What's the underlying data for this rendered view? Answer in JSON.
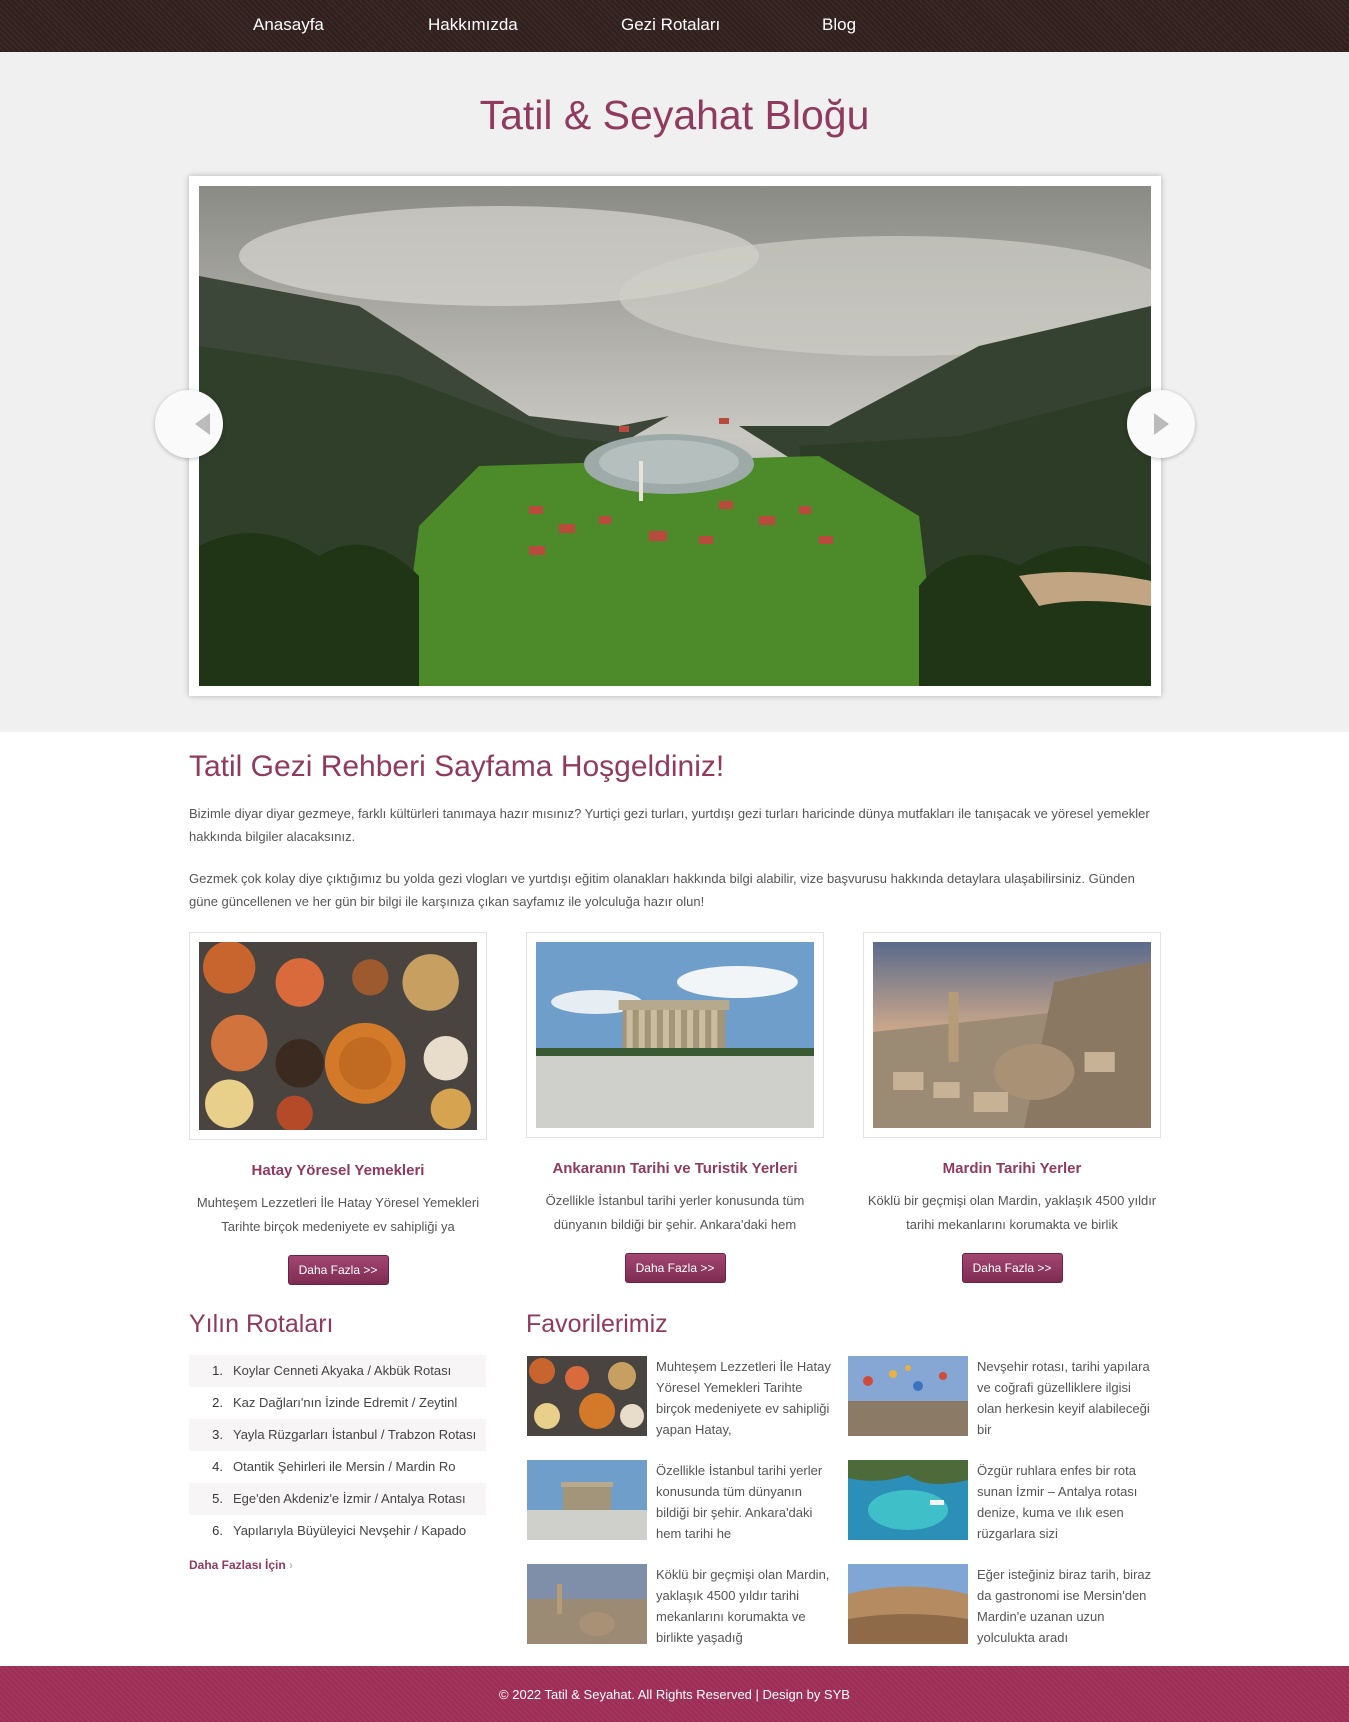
{
  "nav": {
    "items": [
      "Anasayfa",
      "Hakkımızda",
      "Gezi Rotaları",
      "Blog"
    ]
  },
  "hero": {
    "title": "Tatil & Seyahat Bloğu"
  },
  "welcome": {
    "title": "Tatil Gezi Rehberi Sayfama Hoşgeldiniz!",
    "p1": "Bizimle diyar diyar gezmeye, farklı kültürleri tanımaya hazır mısınız? Yurtiçi gezi turları, yurtdışı gezi turları haricinde dünya mutfakları ile tanışacak ve yöresel yemekler hakkında bilgiler alacaksınız.",
    "p2": "Gezmek çok kolay diye çıktığımız bu yolda gezi vlogları ve yurtdışı eğitim olanakları hakkında bilgi alabilir, vize başvurusu hakkında detaylara ulaşabilirsiniz. Günden güne güncellenen ve her gün bir bilgi ile karşınıza çıkan sayfamız ile yolculuğa hazır olun!"
  },
  "cards": [
    {
      "title": "Hatay Yöresel Yemekleri",
      "text": "Muhteşem Lezzetleri İle Hatay Yöresel Yemekleri Tarihte birçok medeniyete ev sahipliği ya",
      "button": "Daha Fazla >>"
    },
    {
      "title": "Ankaranın Tarihi ve Turistik Yerleri",
      "text": "Özellikle İstanbul tarihi yerler konusunda tüm dünyanın bildiği bir şehir. Ankara'daki hem",
      "button": "Daha Fazla >>"
    },
    {
      "title": "Mardin Tarihi Yerler",
      "text": "Köklü bir geçmişi olan Mardin, yaklaşık 4500 yıldır tarihi mekanlarını korumakta ve birlik",
      "button": "Daha Fazla >>"
    }
  ],
  "routes": {
    "title": "Yılın Rotaları",
    "items": [
      {
        "num": "1.",
        "label": "Koylar Cenneti Akyaka / Akbük Rotası"
      },
      {
        "num": "2.",
        "label": "Kaz Dağları'nın İzinde Edremit / Zeytinl"
      },
      {
        "num": "3.",
        "label": "Yayla Rüzgarları İstanbul / Trabzon Rotası"
      },
      {
        "num": "4.",
        "label": "Otantik Şehirleri ile Mersin / Mardin Ro"
      },
      {
        "num": "5.",
        "label": "Ege'den Akdeniz'e İzmir / Antalya Rotası"
      },
      {
        "num": "6.",
        "label": "Yapılarıyla Büyüleyici Nevşehir / Kapado"
      }
    ],
    "more": "Daha Fazlası İçin",
    "more_arrow": "›"
  },
  "favorites": {
    "title": "Favorilerimiz",
    "items": [
      {
        "text": "Muhteşem Lezzetleri İle Hatay Yöresel Yemekleri Tarihte birçok medeniyete ev sahipliği yapan Hatay,"
      },
      {
        "text": "Nevşehir rotası, tarihi yapılara ve coğrafi güzelliklere ilgisi olan herkesin keyif alabileceği bir"
      },
      {
        "text": "Özellikle İstanbul tarihi yerler konusunda tüm dünyanın bildiği bir şehir. Ankara'daki hem tarihi he"
      },
      {
        "text": "Özgür ruhlara enfes bir rota sunan İzmir – Antalya rotası denize, kuma ve ılık esen rüzgarlara sizi"
      },
      {
        "text": "Köklü bir geçmişi olan Mardin, yaklaşık 4500 yıldır tarihi mekanlarını korumakta ve birlikte yaşadığ"
      },
      {
        "text": "Eğer isteğiniz biraz tarih, biraz da gastronomi ise Mersin'den Mardin'e uzanan uzun yolculukta aradı"
      }
    ]
  },
  "footer": {
    "text": "© 2022 Tatil & Seyahat. All Rights Reserved | Design by SYB"
  },
  "colors": {
    "accent": "#8f3a5e",
    "nav_bg": "#2f1f1d",
    "footer_bg": "#9c2e55",
    "hero_bg": "#f0f0f0"
  }
}
